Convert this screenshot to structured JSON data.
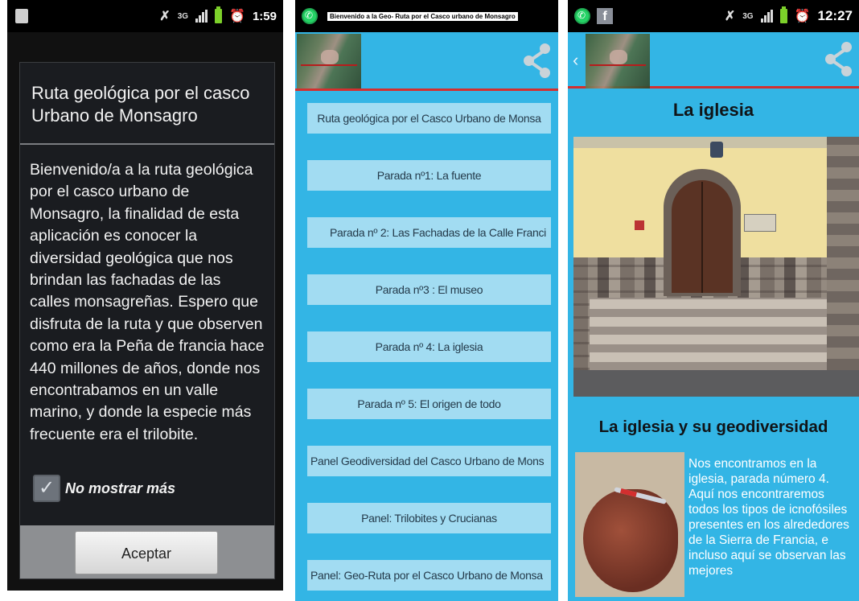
{
  "screen1": {
    "status": {
      "time": "1:59",
      "network": "3G"
    },
    "dialog": {
      "title": "Ruta geológica por el casco Urbano de Monsagro",
      "body": "Bienvenido/a a la ruta geológica por el casco urbano de Monsagro, la finalidad de esta aplicación es conocer la diversidad geológica que nos brindan las fachadas de las calles monsagreñas. Espero que disfruta de la ruta y que observen como era la Peña de francia hace 440 millones de años, donde nos encontrabamos en un valle marino, y donde la especie más frecuente era el trilobite.",
      "checkbox_label": "No mostrar más",
      "checkbox_checked": true,
      "accept_label": "Aceptar"
    }
  },
  "screen2": {
    "status": {
      "notification": "Bienvenido a la Geo- Ruta por el Casco urbano de Monsagro"
    },
    "menu": [
      "Ruta geológica por el Casco Urbano de Monsa",
      "Parada nº1: La fuente",
      "Parada nº 2: Las Fachadas de la Calle Franci",
      "Parada nº3 : El museo",
      "Parada nº 4: La iglesia",
      "Parada nº 5: El origen de todo",
      "Panel Geodiversidad del Casco Urbano de Mons",
      "Panel: Trilobites y Crucianas",
      "Panel: Geo-Ruta por el Casco Urbano de Monsa"
    ]
  },
  "screen3": {
    "status": {
      "time": "12:27",
      "network": "3G"
    },
    "title": "La iglesia",
    "subtitle": "La iglesia y su geodiversidad",
    "body": "Nos encontramos en la iglesia, parada número 4. Aquí nos encontraremos todos los tipos de icnofósiles presentes en los alrededores de la Sierra de Francia, e incluso aquí se observan las mejores"
  },
  "colors": {
    "accent": "#33b5e5",
    "list_item": "#a2dcf2",
    "action_bar_divider": "#d32f2f",
    "dialog_bg": "#1a1c20"
  }
}
